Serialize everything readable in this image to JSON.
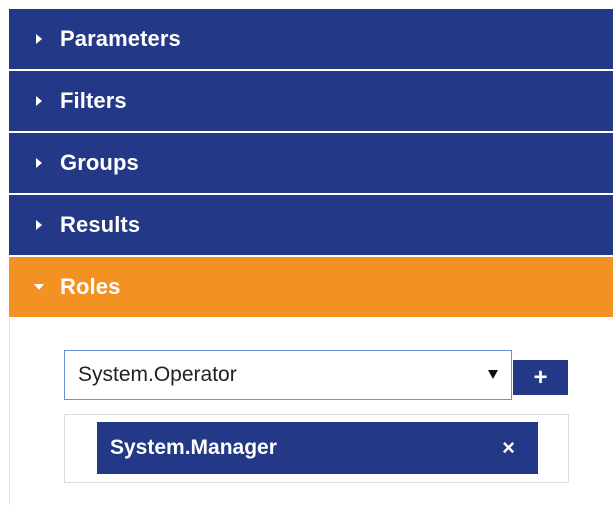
{
  "accordion": {
    "sections": [
      {
        "label": "Parameters",
        "expanded": false
      },
      {
        "label": "Filters",
        "expanded": false
      },
      {
        "label": "Groups",
        "expanded": false
      },
      {
        "label": "Results",
        "expanded": false
      },
      {
        "label": "Roles",
        "expanded": true
      }
    ]
  },
  "roles_panel": {
    "select": {
      "value": "System.Operator"
    },
    "add_button_label": "+",
    "assigned_roles": [
      {
        "label": "System.Manager",
        "remove_label": "×"
      }
    ]
  },
  "colors": {
    "header_bg": "#233886",
    "active_header_bg": "#f39223",
    "text_light": "#ffffff"
  },
  "icons": {
    "collapsed": "caret-right-icon",
    "expanded": "caret-down-icon",
    "select": "dropdown-arrow-icon",
    "add": "plus-icon",
    "remove": "close-icon"
  }
}
